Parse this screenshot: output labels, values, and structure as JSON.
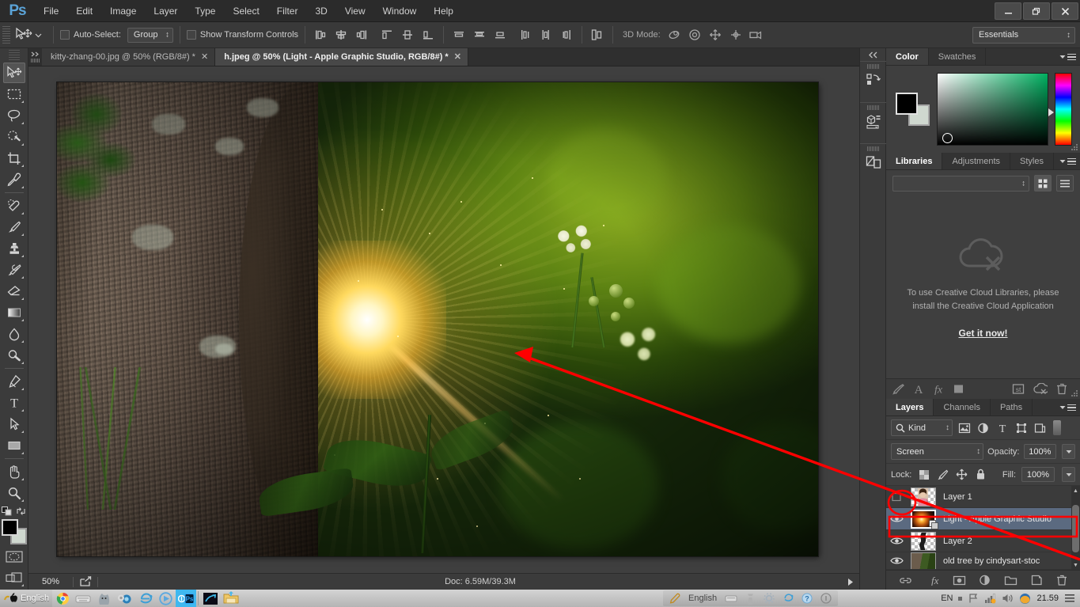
{
  "app": {
    "name": "Adobe Photoshop",
    "logo": "Ps"
  },
  "menubar": {
    "items": [
      "File",
      "Edit",
      "Image",
      "Layer",
      "Type",
      "Select",
      "Filter",
      "3D",
      "View",
      "Window",
      "Help"
    ],
    "window_controls": {
      "minimize": "—",
      "restore": "❐",
      "close": "✕"
    }
  },
  "options_bar": {
    "auto_select_label": "Auto-Select:",
    "auto_select_checked": false,
    "group_value": "Group",
    "show_transform_label": "Show Transform Controls",
    "show_transform_checked": false,
    "mode3d_label": "3D Mode:",
    "workspace": "Essentials",
    "align_icons": [
      "align-left-edges-icon",
      "align-horizontal-centers-icon",
      "align-right-edges-icon",
      "align-top-edges-icon",
      "align-vertical-centers-icon",
      "align-bottom-edges-icon"
    ],
    "distribute_icons": [
      "distribute-top-edges-icon",
      "distribute-vertical-centers-icon",
      "distribute-bottom-edges-icon",
      "distribute-left-edges-icon",
      "distribute-horizontal-centers-icon",
      "distribute-right-edges-icon"
    ],
    "auto_align_icon": "auto-align-layers-icon",
    "mode3d_icons": [
      "rotate-3d-icon",
      "roll-3d-icon",
      "drag-3d-icon",
      "slide-3d-icon",
      "scale-3d-icon"
    ]
  },
  "tabs": [
    {
      "title": "kitty-zhang-00.jpg @ 50% (RGB/8#) *",
      "active": false,
      "close": "✕"
    },
    {
      "title": "h.jpeg @ 50% (Light - Apple Graphic Studio, RGB/8#) *",
      "active": true,
      "close": "✕"
    }
  ],
  "toolbar": {
    "tools": [
      {
        "name": "move-tool",
        "active": true,
        "has_corner": false
      },
      {
        "name": "rectangular-marquee-tool",
        "active": false,
        "has_corner": true
      },
      {
        "name": "lasso-tool",
        "active": false,
        "has_corner": true
      },
      {
        "name": "quick-selection-tool",
        "active": false,
        "has_corner": true
      },
      {
        "name": "crop-tool",
        "active": false,
        "has_corner": true
      },
      {
        "name": "eyedropper-tool",
        "active": false,
        "has_corner": true
      },
      {
        "name": "spot-healing-brush-tool",
        "active": false,
        "has_corner": true
      },
      {
        "name": "brush-tool",
        "active": false,
        "has_corner": true
      },
      {
        "name": "clone-stamp-tool",
        "active": false,
        "has_corner": true
      },
      {
        "name": "history-brush-tool",
        "active": false,
        "has_corner": true
      },
      {
        "name": "eraser-tool",
        "active": false,
        "has_corner": true
      },
      {
        "name": "gradient-tool",
        "active": false,
        "has_corner": true
      },
      {
        "name": "blur-tool",
        "active": false,
        "has_corner": true
      },
      {
        "name": "dodge-tool",
        "active": false,
        "has_corner": true
      },
      {
        "name": "pen-tool",
        "active": false,
        "has_corner": true
      },
      {
        "name": "horizontal-type-tool",
        "active": false,
        "has_corner": true
      },
      {
        "name": "path-selection-tool",
        "active": false,
        "has_corner": true
      },
      {
        "name": "rectangle-tool",
        "active": false,
        "has_corner": true
      },
      {
        "name": "hand-tool",
        "active": false,
        "has_corner": true
      },
      {
        "name": "zoom-tool",
        "active": false,
        "has_corner": true
      }
    ],
    "foreground_color": "#000000",
    "background_color": "#cfd8cf",
    "quick_mask_icon": "quick-mask-mode-icon",
    "screen_mode_icon": "screen-mode-icon",
    "swap_colors_icon": "swap-colors-icon",
    "default_colors_icon": "default-colors-icon"
  },
  "status_bar": {
    "zoom": "50%",
    "share_icon": "share-icon",
    "doc_info": "Doc: 6.59M/39.3M",
    "expand_icon": "play-arrow-icon"
  },
  "rail": {
    "collapse_icon": "collapse-panels-icon",
    "items": [
      "history-panel-icon",
      "properties-panel-icon",
      "layer-comps-panel-icon"
    ]
  },
  "color_panel": {
    "tabs": [
      {
        "label": "Color",
        "active": true
      },
      {
        "label": "Swatches",
        "active": false
      }
    ],
    "menu_icon": "panel-menu-icon",
    "foreground": "#000000",
    "background": "#cfd8cf",
    "hue": "#00b060"
  },
  "libraries_panel": {
    "tabs": [
      {
        "label": "Libraries",
        "active": true
      },
      {
        "label": "Adjustments",
        "active": false
      },
      {
        "label": "Styles",
        "active": false
      }
    ],
    "menu_icon": "panel-menu-icon",
    "select_value": "",
    "grid_view_icon": "grid-view-icon",
    "list_view_icon": "list-view-icon",
    "empty_icon": "cloud-disconnected-icon",
    "empty_text": "To use Creative Cloud Libraries, please install the Creative Cloud Application",
    "link": "Get it now!",
    "footer_icons": [
      "add-graphic-icon",
      "add-character-style-icon",
      "add-layer-style-icon",
      "add-color-icon",
      "sync-icon",
      "cloud-off-icon",
      "delete-icon"
    ]
  },
  "layers_panel": {
    "tabs": [
      {
        "label": "Layers",
        "active": true
      },
      {
        "label": "Channels",
        "active": false
      },
      {
        "label": "Paths",
        "active": false
      }
    ],
    "menu_icon": "panel-menu-icon",
    "filter_label": "Kind",
    "filter_icons": [
      "filter-pixel-icon",
      "filter-adjustment-icon",
      "filter-type-icon",
      "filter-shape-icon",
      "filter-smart-object-icon"
    ],
    "filter_toggle": "filter-enable-toggle",
    "blend_mode": "Screen",
    "opacity_label": "Opacity:",
    "opacity_value": "100%",
    "lock_label": "Lock:",
    "lock_icons": [
      "lock-transparent-pixels-icon",
      "lock-image-pixels-icon",
      "lock-position-icon",
      "lock-all-icon"
    ],
    "fill_label": "Fill:",
    "fill_value": "100%",
    "layers": [
      {
        "name": "Layer 1",
        "visible": false,
        "selected": false,
        "thumb": "portrait-thumb",
        "highlight_circle": true
      },
      {
        "name": "Light - Apple Graphic Studio",
        "visible": true,
        "selected": true,
        "thumb": "light-flare-thumb",
        "linked_smart": true
      },
      {
        "name": "Layer 2",
        "visible": true,
        "selected": false,
        "thumb": "dark-shape-thumb"
      },
      {
        "name": "old tree by cindysart-stoc",
        "visible": true,
        "selected": false,
        "thumb": "tree-thumb"
      }
    ],
    "footer_icons": [
      "link-layers-icon",
      "add-layer-style-icon",
      "add-layer-mask-icon",
      "new-adjustment-layer-icon",
      "new-group-icon",
      "new-layer-icon",
      "delete-layer-icon"
    ]
  },
  "annotations": {
    "arrow_color": "#ff0000",
    "circle_color": "#ff0000",
    "cursor_highlight_color": "#beaa14"
  },
  "taskbar": {
    "language": "English",
    "icons": [
      "apple-icon",
      "chrome-icon",
      "keyboard-icon",
      "cat-icon",
      "webcam-icon",
      "internet-explorer-icon",
      "media-player-icon",
      "photoshop-icon",
      "telenor-icon",
      "folder-icon"
    ],
    "tray_language": "English",
    "tray_icons": [
      "pen-icon",
      "keyboard-tray-icon",
      "chess-icon",
      "gear-icon",
      "ie-tray-icon",
      "help-icon",
      "info-icon"
    ],
    "keyboard_layout": "EN",
    "system_icons": [
      "flag-icon",
      "network-icon",
      "volume-icon",
      "user-icon"
    ],
    "clock": "21.59",
    "show_desktop_icon": "show-desktop-icon"
  }
}
